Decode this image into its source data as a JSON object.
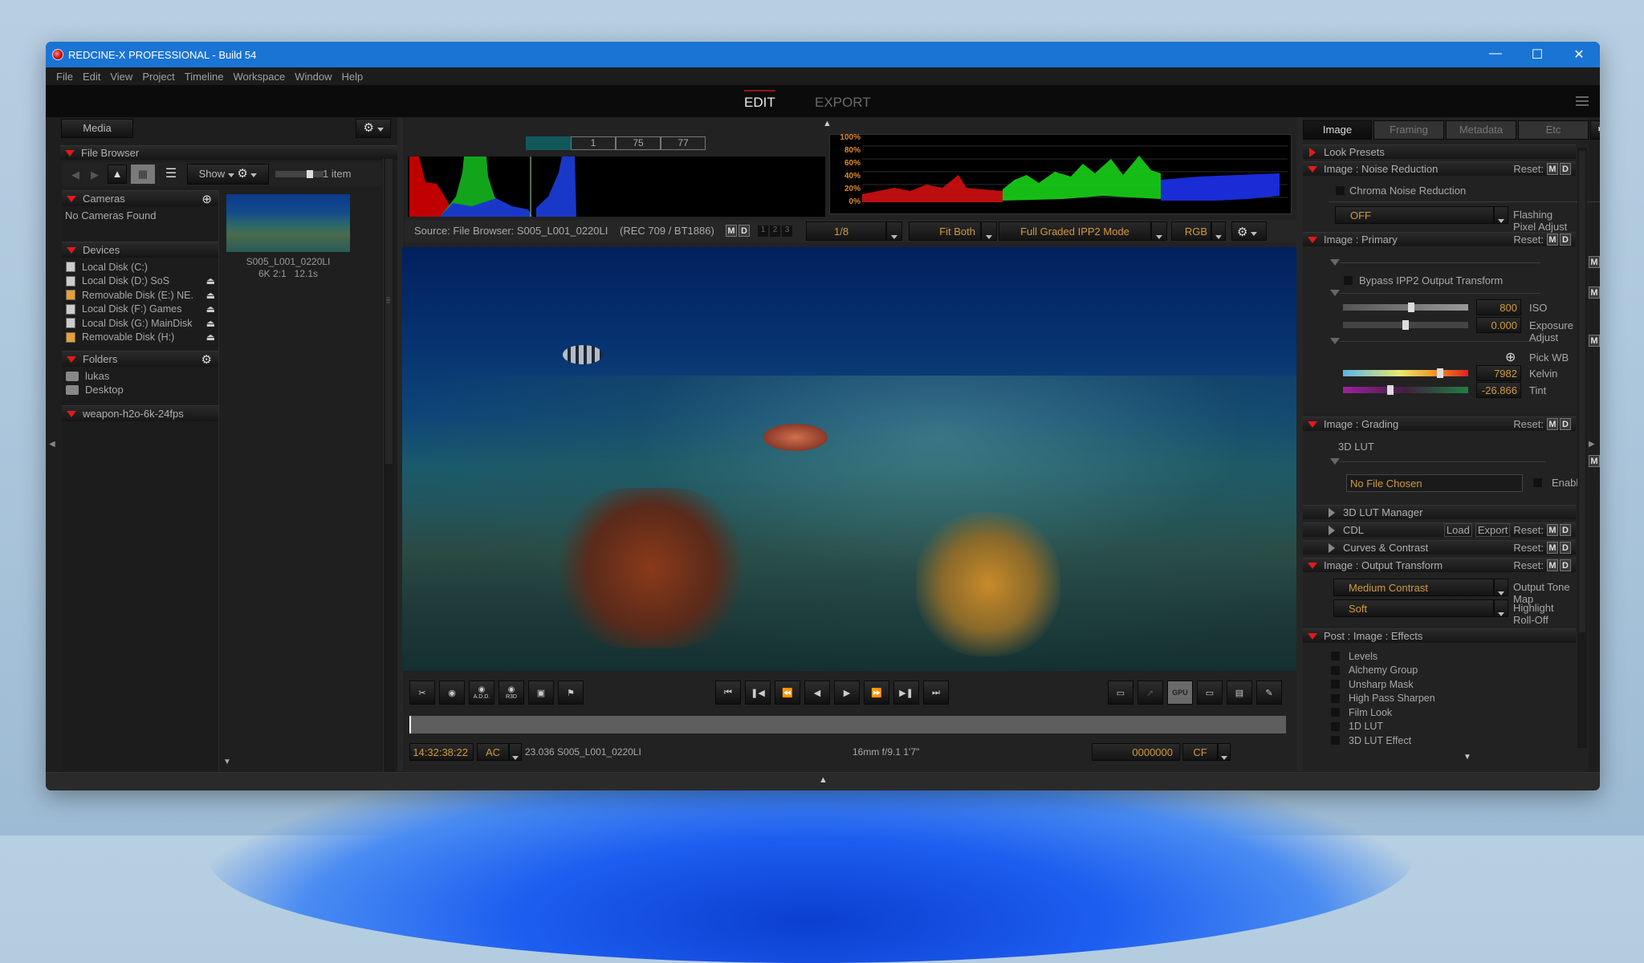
{
  "window": {
    "title": "REDCINE-X PROFESSIONAL - Build 54",
    "controls": [
      "minimize",
      "maximize",
      "close"
    ]
  },
  "menu": [
    "File",
    "Edit",
    "View",
    "Project",
    "Timeline",
    "Workspace",
    "Window",
    "Help"
  ],
  "mode_tabs": {
    "edit": "EDIT",
    "export": "EXPORT",
    "active": "EDIT"
  },
  "left_panel": {
    "tab": "Media",
    "file_browser": {
      "title": "File Browser",
      "show_label": "Show",
      "item_count": "1 item",
      "size_slider_value": 0.75
    },
    "cameras": {
      "title": "Cameras",
      "empty": "No Cameras Found"
    },
    "devices": {
      "title": "Devices",
      "items": [
        {
          "label": "Local Disk (C:)",
          "type": "local",
          "eject": false
        },
        {
          "label": "Local Disk (D:) SoS",
          "type": "local",
          "eject": true
        },
        {
          "label": "Removable Disk (E:) NE.",
          "type": "removable",
          "eject": true
        },
        {
          "label": "Local Disk (F:) Games",
          "type": "local",
          "eject": true
        },
        {
          "label": "Local Disk (G:) MainDisk",
          "type": "local",
          "eject": true
        },
        {
          "label": "Removable Disk (H:)",
          "type": "removable",
          "eject": true
        }
      ]
    },
    "folders": {
      "title": "Folders",
      "items": [
        "lukas",
        "Desktop"
      ]
    },
    "project": {
      "title": "weapon-h2o-6k-24fps"
    },
    "clip": {
      "name": "S005_L001_0220LI",
      "format": "6K 2:1",
      "duration": "12.1s"
    }
  },
  "viewer": {
    "histogram_readouts": [
      "1",
      "75",
      "77"
    ],
    "waveform_ticks": [
      "100%",
      "80%",
      "60%",
      "40%",
      "20%",
      "0%"
    ],
    "source_label": "Source: File Browser: S005_L001_0220LI",
    "colorspace": "(REC 709 / BT1886)",
    "md": [
      "M",
      "D"
    ],
    "layers": [
      "1",
      "2",
      "3"
    ],
    "resolution": "1/8",
    "fit": "Fit Both",
    "mode": "Full Graded IPP2 Mode",
    "channel": "RGB",
    "left_tools": [
      {
        "name": "trim-tool-icon",
        "sub": ""
      },
      {
        "name": "snapshot-icon",
        "sub": ""
      },
      {
        "name": "snapshot-add-icon",
        "sub": "A.D.D."
      },
      {
        "name": "snapshot-r3d-icon",
        "sub": "R3D"
      },
      {
        "name": "frame-export-icon",
        "sub": ""
      },
      {
        "name": "marker-flag-icon",
        "sub": ""
      }
    ],
    "transport": [
      "go-to-start",
      "previous-clip",
      "rewind",
      "step-back",
      "play",
      "fast-forward",
      "next-clip",
      "go-to-end"
    ],
    "transport_glyphs": [
      "⏮",
      "⏮",
      "⏪",
      "◀",
      "▶",
      "⏩",
      "⏭",
      "⏭"
    ],
    "right_tools": [
      {
        "name": "monitor-icon",
        "label": "▭"
      },
      {
        "name": "rocket-icon",
        "label": "✈"
      },
      {
        "name": "gpu-icon",
        "label": "GPU"
      },
      {
        "name": "safe-area-icon",
        "label": "▭"
      },
      {
        "name": "clapper-icon",
        "label": "▤"
      },
      {
        "name": "trim-out-icon",
        "label": "✎"
      }
    ],
    "playhead_position": 0.0,
    "timecode": "14:32:38:22",
    "tc_mode": "AC",
    "clip_info": "23.036 S005_L001_0220LI",
    "lens_info": "16mm  f/9.1  1'7\"",
    "frame_counter": "0000000",
    "counter_mode": "CF"
  },
  "right_panel": {
    "tabs": [
      "Image",
      "Framing",
      "Metadata",
      "Etc"
    ],
    "active_tab": "Image",
    "reset_label": "Reset:",
    "look_presets": "Look Presets",
    "noise_reduction": {
      "title": "Image : Noise Reduction",
      "chroma_label": "Chroma Noise Reduction",
      "flashing_value": "OFF",
      "flashing_label": "Flashing Pixel Adjust"
    },
    "primary": {
      "title": "Image : Primary",
      "bypass_label": "Bypass IPP2 Output Transform",
      "iso": {
        "value": "800",
        "label": "ISO",
        "slider": 0.55
      },
      "exposure": {
        "value": "0.000",
        "label": "Exposure Adjust",
        "slider": 0.5
      },
      "pick_wb": "Pick WB",
      "kelvin": {
        "value": "7982",
        "label": "Kelvin",
        "slider": 0.79
      },
      "tint": {
        "value": "-26.866",
        "label": "Tint",
        "slider": 0.37
      }
    },
    "grading": {
      "title": "Image : Grading",
      "lut_label": "3D LUT",
      "file_value": "No File Chosen",
      "enable_label": "Enable",
      "lut_manager": "3D LUT Manager",
      "cdl": "CDL",
      "load": "Load",
      "export": "Export",
      "curves": "Curves & Contrast"
    },
    "output_transform": {
      "title": "Image : Output Transform",
      "tone_map_value": "Medium Contrast",
      "tone_map_label": "Output Tone Map",
      "rolloff_value": "Soft",
      "rolloff_label": "Highlight Roll-Off"
    },
    "effects": {
      "title": "Post : Image : Effects",
      "items": [
        "Levels",
        "Alchemy Group",
        "Unsharp Mask",
        "High Pass Sharpen",
        "Film Look",
        "1D LUT",
        "3D LUT Effect"
      ]
    }
  },
  "colors": {
    "accent_red": "#e01a1a",
    "value_orange": "#d29a3c",
    "titlebar_blue": "#1a74d4"
  }
}
